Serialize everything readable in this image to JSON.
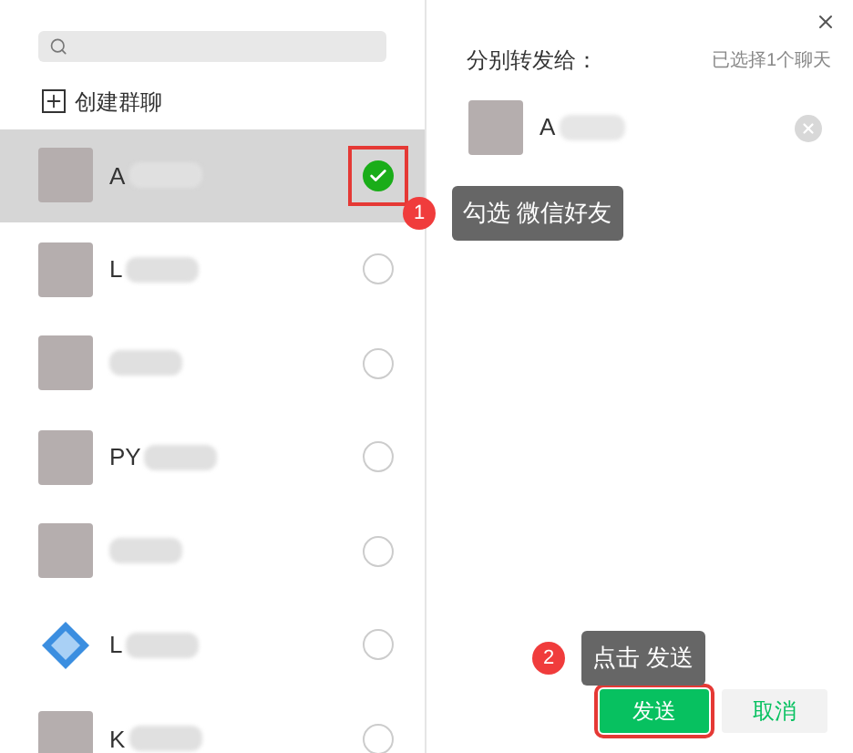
{
  "create_group": {
    "label": "创建群聊"
  },
  "contacts": [
    {
      "name": "A",
      "kind": "photo",
      "selected": true
    },
    {
      "name": "L",
      "kind": "photo",
      "selected": false
    },
    {
      "kind": "photo",
      "selected": false
    },
    {
      "name": "PY",
      "kind": "photo",
      "selected": false
    },
    {
      "kind": "photo",
      "selected": false
    },
    {
      "name": "L",
      "kind": "logo",
      "selected": false
    },
    {
      "name": "K",
      "kind": "photo",
      "selected": false
    }
  ],
  "forward_panel": {
    "title": "分别转发给：",
    "count": "已选择1个聊天",
    "recipients": [
      {
        "name": "A"
      }
    ]
  },
  "buttons": [
    {
      "label": "发送",
      "kind": "primary"
    },
    {
      "label": "取消",
      "kind": "secondary"
    }
  ],
  "annotations": [
    {
      "number": "1",
      "text": "勾选 微信好友"
    },
    {
      "number": "2",
      "text": "点击 发送"
    }
  ]
}
